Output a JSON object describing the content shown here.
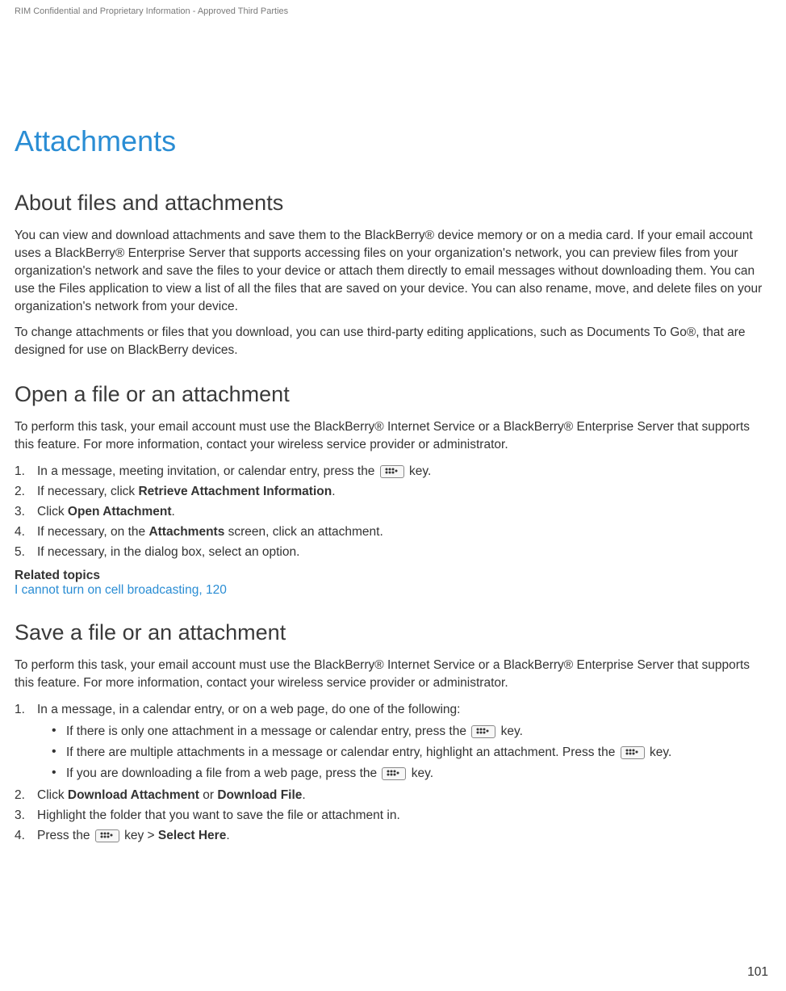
{
  "header": {
    "confidential": "RIM Confidential and Proprietary Information - Approved Third Parties"
  },
  "title": "Attachments",
  "sections": {
    "about": {
      "heading": "About files and attachments",
      "p1": "You can view and download attachments and save them to the BlackBerry® device memory or on a media card. If your email account uses a BlackBerry® Enterprise Server that supports accessing files on your organization's network, you can preview files from your organization's network and save the files to your device or attach them directly to email messages without downloading them. You can use the Files application to view a list of all the files that are saved on your device. You can also rename, move, and delete files on your organization's network from your device.",
      "p2": "To change attachments or files that you download, you can use third-party editing applications, such as Documents To Go®, that are designed for use on BlackBerry devices."
    },
    "open": {
      "heading": "Open a file or an attachment",
      "intro": "To perform this task, your email account must use the BlackBerry® Internet Service or a BlackBerry® Enterprise Server that supports this feature. For more information, contact your wireless service provider or administrator.",
      "steps": {
        "s1_pre": "In a message, meeting invitation, or calendar entry, press the ",
        "s1_post": " key.",
        "s2_pre": "If necessary, click ",
        "s2_bold": "Retrieve Attachment Information",
        "s2_post": ".",
        "s3_pre": "Click ",
        "s3_bold": "Open Attachment",
        "s3_post": ".",
        "s4_pre": "If necessary, on the ",
        "s4_bold": "Attachments",
        "s4_post": " screen, click an attachment.",
        "s5": "If necessary, in the dialog box, select an option."
      },
      "related_heading": "Related topics",
      "related_link": "I cannot turn on cell broadcasting, 120"
    },
    "save": {
      "heading": "Save a file or an attachment",
      "intro": "To perform this task, your email account must use the BlackBerry® Internet Service or a BlackBerry® Enterprise Server that supports this feature. For more information, contact your wireless service provider or administrator.",
      "steps": {
        "s1": "In a message, in a calendar entry, or on a web page, do one of the following:",
        "s1b1_pre": "If there is only one attachment in a message or calendar entry, press the ",
        "s1b1_post": " key.",
        "s1b2_pre": "If there are multiple attachments in a message or calendar entry, highlight an attachment. Press the ",
        "s1b2_post": " key.",
        "s1b3_pre": "If you are downloading a file from a web page, press the ",
        "s1b3_post": " key.",
        "s2_pre": "Click ",
        "s2_bold1": "Download Attachment",
        "s2_mid": " or ",
        "s2_bold2": "Download File",
        "s2_post": ".",
        "s3": "Highlight the folder that you want to save the file or attachment in.",
        "s4_pre": "Press the ",
        "s4_mid": " key > ",
        "s4_bold": "Select Here",
        "s4_post": "."
      }
    }
  },
  "pageNumber": "101"
}
